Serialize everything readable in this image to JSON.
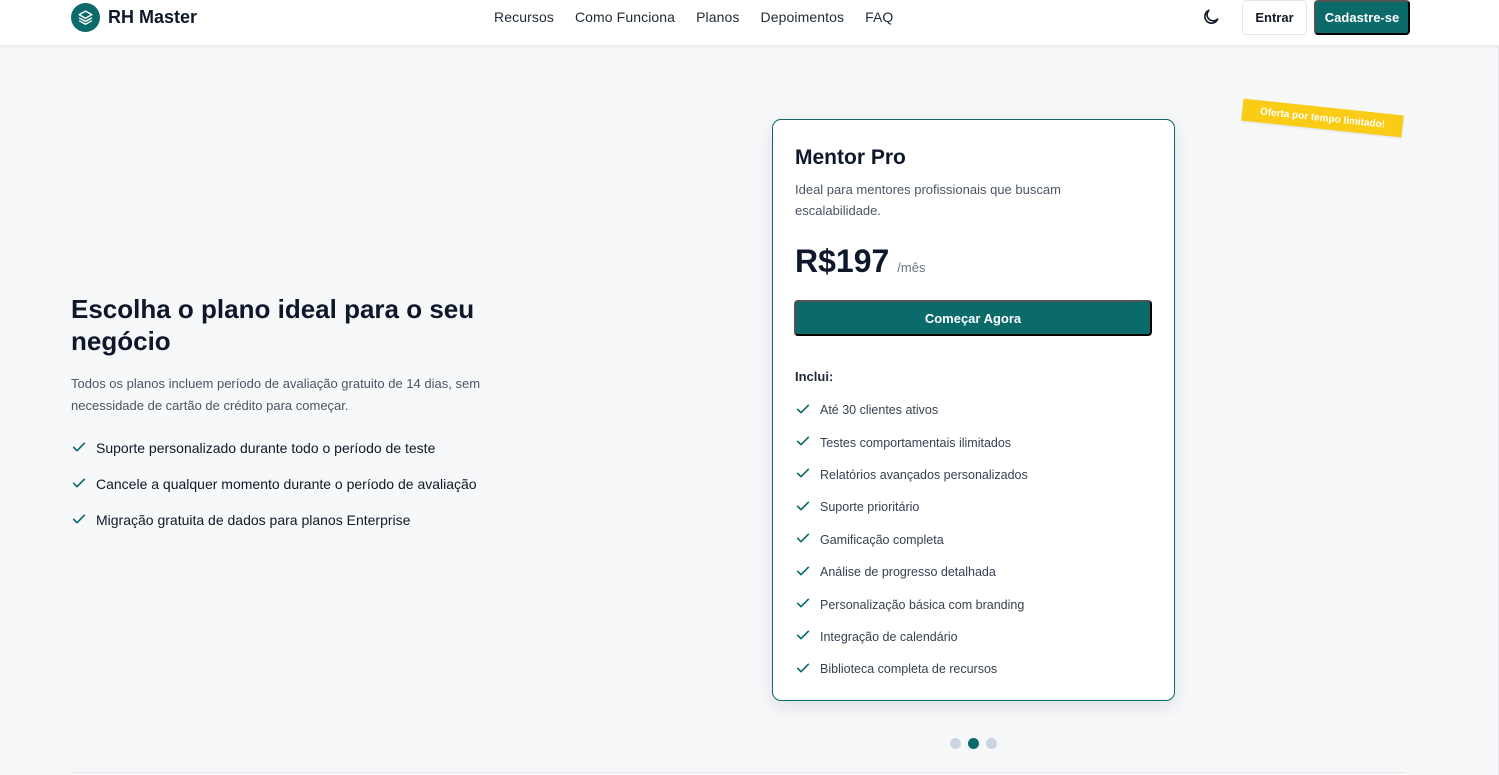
{
  "header": {
    "brand": "RH Master",
    "nav": [
      {
        "label": "Recursos"
      },
      {
        "label": "Como Funciona"
      },
      {
        "label": "Planos"
      },
      {
        "label": "Depoimentos"
      },
      {
        "label": "FAQ"
      }
    ],
    "login_label": "Entrar",
    "signup_label": "Cadastre-se"
  },
  "hero": {
    "title": "Escolha o plano ideal para o seu negócio",
    "subtitle": "Todos os planos incluem período de avaliação gratuito de 14 dias, sem necessidade de cartão de crédito para começar.",
    "benefits": [
      {
        "text": "Suporte personalizado durante todo o período de teste"
      },
      {
        "text": "Cancele a qualquer momento durante o período de avaliação"
      },
      {
        "text": "Migração gratuita de dados para planos Enterprise"
      }
    ]
  },
  "plan": {
    "ribbon": "Oferta por tempo limitado!",
    "name": "Mentor Pro",
    "description": "Ideal para mentores profissionais que buscam escalabilidade.",
    "price": "R$197",
    "period": "/mês",
    "cta": "Começar Agora",
    "includes_title": "Inclui:",
    "features": [
      {
        "text": "Até 30 clientes ativos"
      },
      {
        "text": "Testes comportamentais ilimitados"
      },
      {
        "text": "Relatórios avançados personalizados"
      },
      {
        "text": "Suporte prioritário"
      },
      {
        "text": "Gamificação completa"
      },
      {
        "text": "Análise de progresso detalhada"
      },
      {
        "text": "Personalização básica com branding"
      },
      {
        "text": "Integração de calendário"
      },
      {
        "text": "Biblioteca completa de recursos"
      }
    ]
  },
  "carousel": {
    "total": 3,
    "active_index": 1
  },
  "colors": {
    "primary": "#0b6a6a",
    "ribbon": "#facc15",
    "background": "#f7f8fa"
  },
  "icons": {
    "brand": "layers-icon",
    "theme": "moon-icon",
    "check": "check-icon"
  }
}
